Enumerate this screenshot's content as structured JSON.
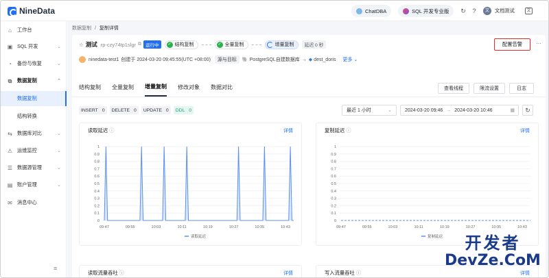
{
  "header": {
    "logo_text": "NineData",
    "chatdba_label": "ChatDBA",
    "sql_pro_label": "SQL 开发专业版",
    "user_name": "文档测试",
    "user_initial": "文"
  },
  "sidebar": {
    "items": [
      {
        "label": "工作台",
        "icon": "home-icon"
      },
      {
        "label": "SQL 开发",
        "icon": "terminal-icon"
      },
      {
        "label": "备份与恢复",
        "icon": "backup-icon"
      },
      {
        "label": "数据复制",
        "icon": "copy-icon"
      },
      {
        "label": "数据库对比",
        "icon": "compare-icon"
      },
      {
        "label": "运维监控",
        "icon": "monitor-icon"
      },
      {
        "label": "数据源管理",
        "icon": "database-icon"
      },
      {
        "label": "账户管理",
        "icon": "user-icon"
      },
      {
        "label": "消息中心",
        "icon": "mail-icon"
      }
    ],
    "sub_items": [
      {
        "label": "数据复制"
      },
      {
        "label": "结构转换"
      }
    ]
  },
  "breadcrumb": {
    "parent": "数据复制",
    "sep": "/",
    "current": "复制详情"
  },
  "task": {
    "name": "测试",
    "id": "rp-czy74tp1slgr",
    "status": "运行中",
    "steps": [
      "结构复制",
      "全量复制",
      "增量复制"
    ],
    "delay": "延迟 0 秒",
    "alert_button": "配置告警",
    "creator": "ninedata-test1",
    "created_text": "创建于 2024-03-20 09:45:55(UTC +08:00)",
    "src_dst_label": "源与目标",
    "source": "PostgreSQL自建数据库",
    "arrow": "→",
    "target": "dest_doris",
    "more": "更多"
  },
  "tabs": [
    "结构复制",
    "全量复制",
    "增量复制",
    "修改对象",
    "数据对比"
  ],
  "actions": {
    "view_threads": "查看线程",
    "throttle": "限流设置",
    "log": "日志"
  },
  "ops": [
    {
      "label": "INSERT",
      "value": "0"
    },
    {
      "label": "DELETE",
      "value": "0"
    },
    {
      "label": "UPDATE",
      "value": "0"
    },
    {
      "label": "DDL",
      "value": "0"
    }
  ],
  "time_range": {
    "preset": "最近 1 小时",
    "start": "2024-03-20 09:46",
    "sep": "→",
    "end": "2024-03-20 10:46"
  },
  "charts": {
    "read_delay_title": "读取延迟",
    "copy_delay_title": "复制延迟",
    "read_flow_title": "读取流量吞吐",
    "write_flow_title": "写入流量吞吐",
    "details": "详情"
  },
  "chart_data": [
    {
      "type": "area",
      "title": "读取延迟",
      "x_ticks": [
        "09:47",
        "09:55",
        "10:03",
        "10:11",
        "10:19",
        "10:27",
        "10:35",
        "10:43"
      ],
      "y_ticks": [
        "0",
        "0.1",
        "0.2",
        "0.3",
        "0.4",
        "0.5",
        "0.6",
        "0.7",
        "0.8",
        "0.9",
        "1"
      ],
      "ylim": [
        0,
        1
      ],
      "legend": "读取延迟",
      "series": [
        {
          "name": "读取延迟",
          "x": [
            0,
            0.5,
            1,
            11,
            11.5,
            12,
            18,
            18.5,
            19,
            25,
            25.5,
            26,
            41,
            41.5,
            42,
            49,
            49.5,
            50,
            57,
            57.5,
            58,
            60
          ],
          "values": [
            0,
            1,
            0,
            0,
            1,
            0,
            0,
            1,
            0,
            0,
            1,
            0,
            0,
            1,
            0,
            0,
            1,
            0,
            0,
            1,
            0,
            0
          ]
        }
      ]
    },
    {
      "type": "line",
      "title": "复制延迟",
      "x_ticks": [
        "09:47",
        "09:55",
        "10:03",
        "10:11",
        "10:19",
        "10:27",
        "10:35",
        "10:43"
      ],
      "y_ticks": [
        "0",
        "0.1",
        "0.2",
        "0.3",
        "0.4",
        "0.5",
        "0.6",
        "0.7",
        "0.8",
        "0.9",
        "1"
      ],
      "ylim": [
        0,
        1
      ],
      "legend": "复制延迟",
      "series": [
        {
          "name": "复制延迟",
          "x": [
            0,
            60
          ],
          "values": [
            0,
            0
          ]
        }
      ]
    }
  ],
  "colors": {
    "accent": "#1f6ef5",
    "alert_border": "#e02b2b",
    "ok": "#27b24a"
  },
  "watermark": {
    "line1": "开发者",
    "line2": "DevZe.CoM"
  }
}
